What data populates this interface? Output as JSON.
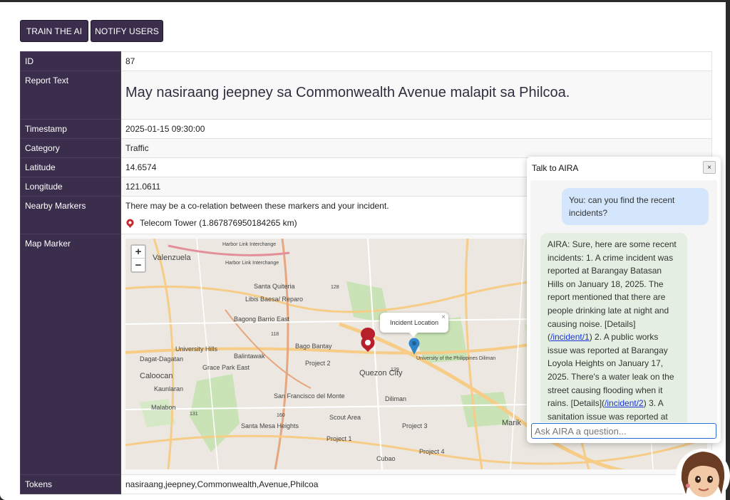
{
  "toolbar": {
    "train_label": "TRAIN THE AI",
    "notify_label": "NOTIFY USERS"
  },
  "fields": {
    "id": {
      "label": "ID",
      "value": "87"
    },
    "report_text": {
      "label": "Report Text",
      "value": "May nasiraang jeepney sa Commonwealth Avenue malapit sa Philcoa."
    },
    "timestamp": {
      "label": "Timestamp",
      "value": "2025-01-15 09:30:00"
    },
    "category": {
      "label": "Category",
      "value": "Traffic"
    },
    "latitude": {
      "label": "Latitude",
      "value": "14.6574"
    },
    "longitude": {
      "label": "Longitude",
      "value": "121.0611"
    },
    "nearby": {
      "label": "Nearby Markers",
      "note": "There may be a co-relation between these markers and your incident.",
      "marker": "Telecom Tower (1.867876950184265 km)"
    },
    "map_marker": {
      "label": "Map Marker"
    },
    "tokens": {
      "label": "Tokens",
      "value": "nasiraang,jeepney,Commonwealth,Avenue,Philcoa"
    }
  },
  "map": {
    "zoom_in": "+",
    "zoom_out": "−",
    "popup": "Incident Location",
    "popup_close": "×",
    "labels": {
      "valenzuela": "Valenzuela",
      "santa_quiteria": "Santa Quiteria",
      "libis": "Libis Baesa/ Reparo",
      "bagong_barrio": "Bagong Barrio East",
      "university_hills": "University Hills",
      "bago_bantay": "Bago Bantay",
      "balintawak": "Balintawak",
      "dagat": "Dagat-Dagatan",
      "grace_park": "Grace Park East",
      "caloocan": "Caloocan",
      "project2": "Project 2",
      "quezon_city": "Quezon City",
      "up": "University of the Philippines Diliman",
      "dilliman": "Diliman",
      "kaunlaran": "Kaunlaran",
      "malabon": "Malabon",
      "sfdm": "San Francisco del Monte",
      "scout_area": "Scout Area",
      "santa_mesa": "Santa Mesa Heights",
      "project1": "Project 1",
      "project4": "Project 4",
      "project3": "Project 3",
      "cubao": "Cubao",
      "marik": "Marik",
      "harbor1": "Harbor Link Interchange",
      "harbor2": "Harbor Link Interchange",
      "r128": "128",
      "r129": "129",
      "r118": "118",
      "r131": "131",
      "r160": "160"
    }
  },
  "chat": {
    "title": "Talk to AIRA",
    "close": "×",
    "user_msg": "You: can you find the recent incidents?",
    "ai_part1": "AIRA: Sure, here are some recent incidents: 1. A crime incident was reported at Barangay Batasan Hills on January 18, 2025. The report mentioned that there are people drinking late at night and causing noise. [Details](",
    "ai_link1": "/incident/1",
    "ai_part2": ") 2. A public works issue was reported at Barangay Loyola Heights on January 17, 2025. There's a water leak on the street causing flooding when it rains. [Details](",
    "ai_link2": "/incident/2",
    "ai_part3": ") 3. A sanitation issue was reported at",
    "placeholder": "Ask AIRA a question..."
  },
  "colors": {
    "header_bg": "#3a2e4c",
    "user_bubble": "#d3e6fb",
    "ai_bubble": "#e4efe1",
    "link": "#1a33d8"
  }
}
